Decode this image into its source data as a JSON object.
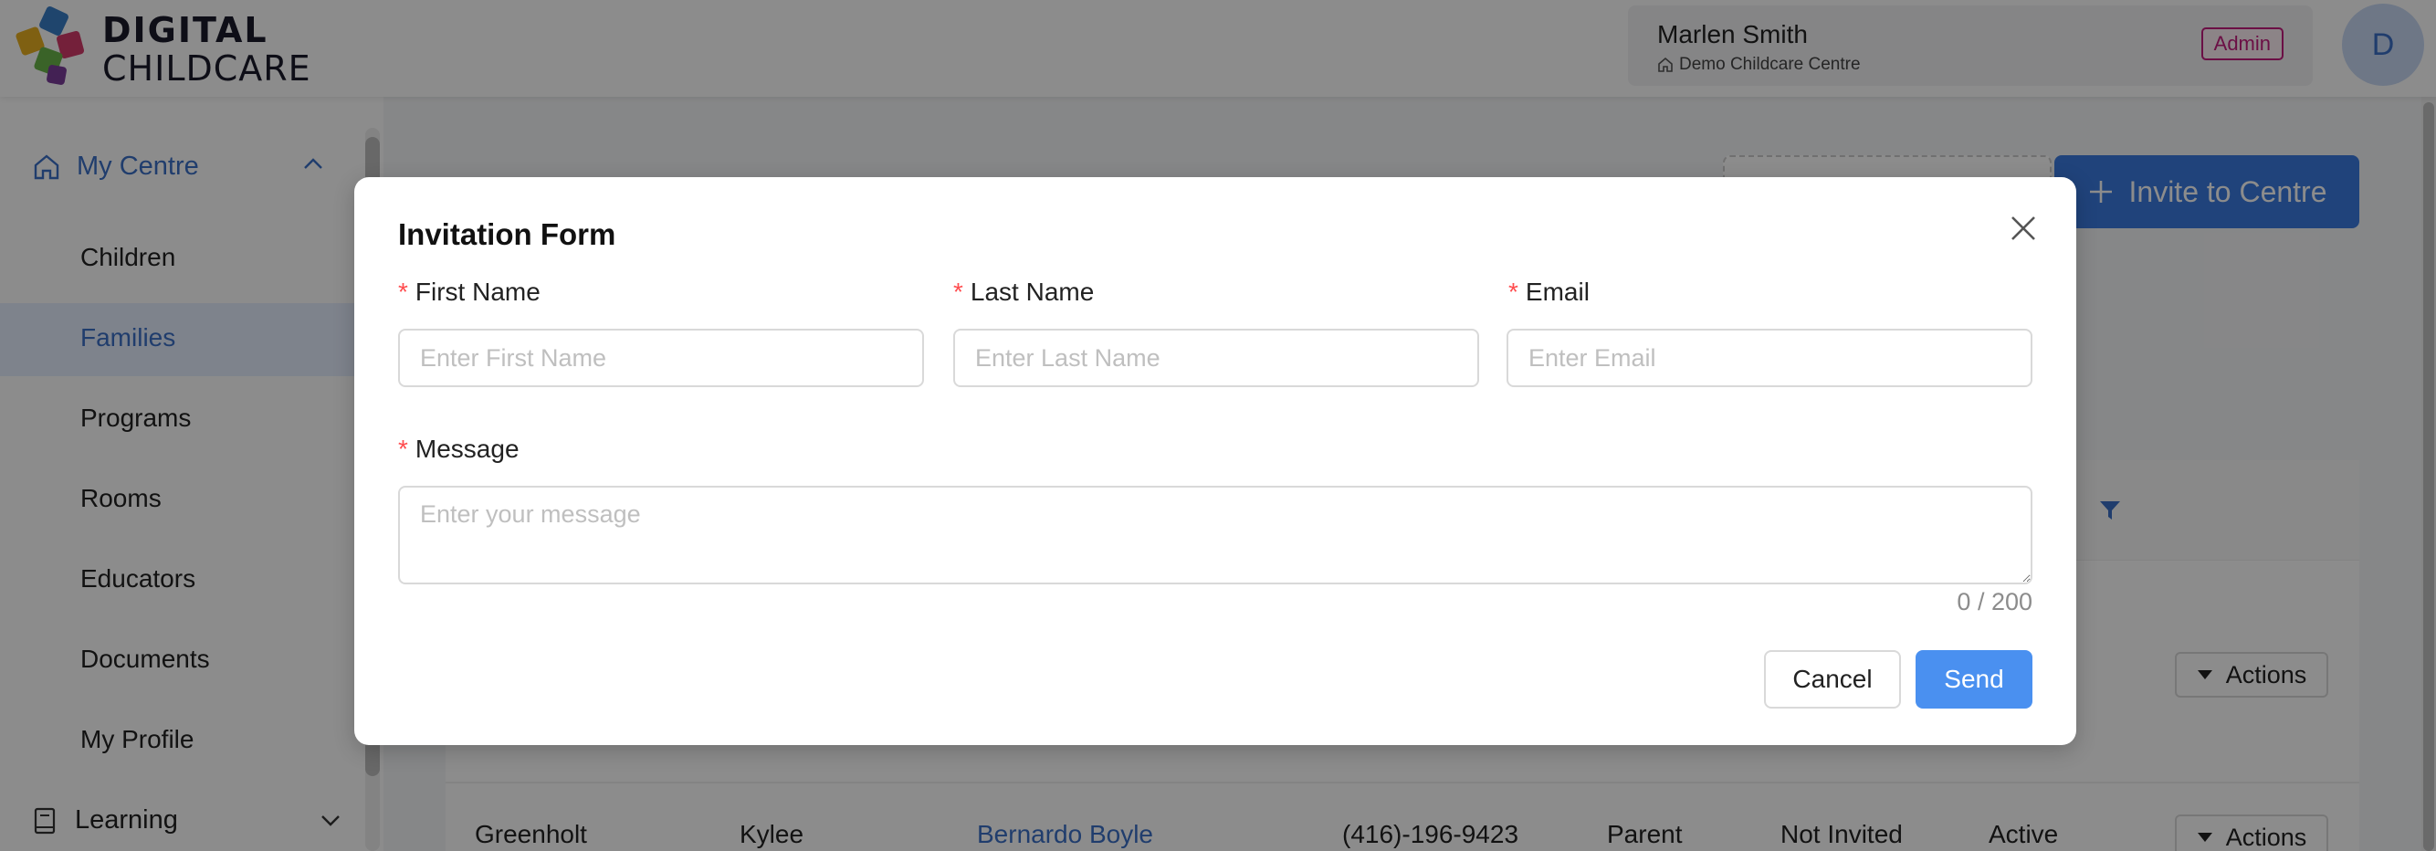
{
  "brand": {
    "line1": "DIGITAL",
    "line2": "CHILDCARE"
  },
  "user": {
    "name": "Marlen Smith",
    "centre": "Demo Childcare Centre",
    "role": "Admin",
    "avatar_initial": "D"
  },
  "sidebar": {
    "group_label": "My Centre",
    "items": [
      {
        "label": "Children"
      },
      {
        "label": "Families"
      },
      {
        "label": "Programs"
      },
      {
        "label": "Rooms"
      },
      {
        "label": "Educators"
      },
      {
        "label": "Documents"
      },
      {
        "label": "My Profile"
      }
    ],
    "learning_label": "Learning"
  },
  "main": {
    "invite_label": "Invite to Centre",
    "actions_label": "Actions",
    "row": {
      "last_name": "Greenholt",
      "first_name": "Kylee",
      "contact": "Bernardo Boyle",
      "phone": "(416)-196-9423",
      "relation": "Parent",
      "invite_status": "Not Invited",
      "status": "Active"
    }
  },
  "modal": {
    "title": "Invitation Form",
    "first_name": {
      "label": "First Name",
      "placeholder": "Enter First Name",
      "value": ""
    },
    "last_name": {
      "label": "Last Name",
      "placeholder": "Enter Last Name",
      "value": ""
    },
    "email": {
      "label": "Email",
      "placeholder": "Enter Email",
      "value": ""
    },
    "message": {
      "label": "Message",
      "placeholder": "Enter your message",
      "value": ""
    },
    "counter": "0 / 200",
    "cancel_label": "Cancel",
    "send_label": "Send"
  },
  "colors": {
    "accent": "#3b7be0",
    "admin": "#c41d7f",
    "required": "#ff4d4f"
  }
}
